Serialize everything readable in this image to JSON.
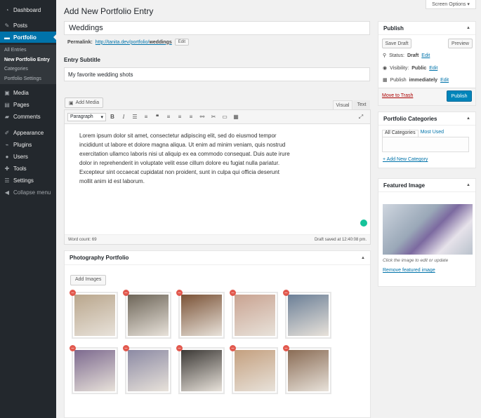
{
  "sidebar": {
    "items": [
      {
        "label": "Dashboard",
        "icon": "dashboard-icon"
      },
      {
        "label": "Posts",
        "icon": "pin-icon"
      },
      {
        "label": "Portfolio",
        "icon": "folder-icon"
      },
      {
        "label": "Media",
        "icon": "media-icon"
      },
      {
        "label": "Pages",
        "icon": "page-icon"
      },
      {
        "label": "Comments",
        "icon": "comment-icon"
      },
      {
        "label": "Appearance",
        "icon": "brush-icon"
      },
      {
        "label": "Plugins",
        "icon": "plug-icon"
      },
      {
        "label": "Users",
        "icon": "user-icon"
      },
      {
        "label": "Tools",
        "icon": "wrench-icon"
      },
      {
        "label": "Settings",
        "icon": "settings-icon"
      },
      {
        "label": "Collapse menu",
        "icon": "collapse-icon"
      }
    ],
    "submenu": [
      "All Entries",
      "New Portfolio Entry",
      "Categories",
      "Portfolio Settings"
    ]
  },
  "header": {
    "screen_options": "Screen Options",
    "title": "Add New Portfolio Entry"
  },
  "post": {
    "title": "Weddings",
    "permalink_label": "Permalink:",
    "permalink_url": "http://tanita.dev/portfolio/",
    "permalink_slug": "weddings",
    "edit_label": "Edit",
    "subtitle_label": "Entry Subtitle",
    "subtitle_value": "My favorite wedding shots"
  },
  "editor": {
    "add_media": "Add Media",
    "tab_visual": "Visual",
    "tab_text": "Text",
    "format": "Paragraph",
    "content": "Lorem ipsum dolor sit amet, consectetur adipiscing elit, sed do eiusmod tempor incididunt ut labore et dolore magna aliqua. Ut enim ad minim veniam, quis nostrud exercitation ullamco laboris nisi ut aliquip ex ea commodo consequat. Duis aute irure dolor in reprehenderit in voluptate velit esse cillum dolore eu fugiat nulla pariatur. Excepteur sint occaecat cupidatat non proident, sunt in culpa qui officia deserunt mollit anim id est laborum.",
    "word_count": "Word count: 69",
    "draft_saved": "Draft saved at 12:40:08 pm."
  },
  "portfolio": {
    "title": "Photography Portfolio",
    "add_images": "Add Images",
    "images": [
      {
        "alt": "bride-bouquet-icon",
        "color": "#b9a68c"
      },
      {
        "alt": "lace-dress-icon",
        "color": "#6d6558"
      },
      {
        "alt": "bridesmaids-icon",
        "color": "#7a5236"
      },
      {
        "alt": "hands-rings-icon",
        "color": "#c9a391"
      },
      {
        "alt": "couple-kiss-icon",
        "color": "#6b7f97"
      },
      {
        "alt": "couple-walk-icon",
        "color": "#7d6a8f"
      },
      {
        "alt": "bride-flowers-icon",
        "color": "#8c8aa4"
      },
      {
        "alt": "dresses-rack-icon",
        "color": "#3c3936"
      },
      {
        "alt": "reception-hall-icon",
        "color": "#c4a07f"
      },
      {
        "alt": "bride-back-icon",
        "color": "#8a6c55"
      }
    ]
  },
  "publish": {
    "title": "Publish",
    "save_draft": "Save Draft",
    "preview": "Preview",
    "status_label": "Status:",
    "status_value": "Draft",
    "visibility_label": "Visibility:",
    "visibility_value": "Public",
    "publish_label": "Publish",
    "publish_value": "immediately",
    "edit": "Edit",
    "trash": "Move to Trash",
    "publish_button": "Publish"
  },
  "categories": {
    "title": "Portfolio Categories",
    "tab_all": "All Categories",
    "tab_used": "Most Used",
    "add_new": "+ Add New Category"
  },
  "featured": {
    "title": "Featured Image",
    "hint": "Click the image to edit or update",
    "remove": "Remove featured image"
  },
  "colors": {
    "sidebar_bg": "#23282d",
    "accent": "#0073aa",
    "primary_button": "#0085ba",
    "trash": "#a00"
  }
}
